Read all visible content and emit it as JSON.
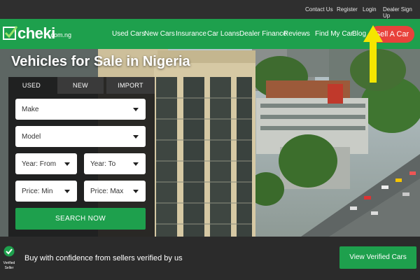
{
  "topbar": {
    "links": [
      "Contact Us",
      "Register",
      "Login",
      "Dealer Sign Up"
    ]
  },
  "brand": {
    "name": "cheki",
    "tld": ".com.ng",
    "color": "#1ea04d"
  },
  "nav": {
    "items": [
      "Used Cars",
      "New Cars",
      "Insurance",
      "Car Loans",
      "Dealer Finance",
      "Reviews",
      "Find My Car",
      "Blog"
    ],
    "sell_label": "Sell A Car",
    "sell_color": "#e8423b"
  },
  "hero": {
    "title": "Vehicles for Sale in Nigeria"
  },
  "search": {
    "tabs": [
      "USED",
      "NEW",
      "IMPORT"
    ],
    "active_tab": "USED",
    "make": "Make",
    "model": "Model",
    "year_from": "Year: From",
    "year_to": "Year: To",
    "price_min": "Price: Min",
    "price_max": "Price: Max",
    "submit_label": "SEARCH NOW"
  },
  "annotation": {
    "icon": "yellow-arrow-up-icon",
    "color": "#f5e600"
  },
  "trust": {
    "badge_icon": "verified-check-icon",
    "badge_text": "Verified Seller",
    "message": "Buy with confidence from sellers verified by us",
    "cta_label": "View Verified Cars"
  }
}
